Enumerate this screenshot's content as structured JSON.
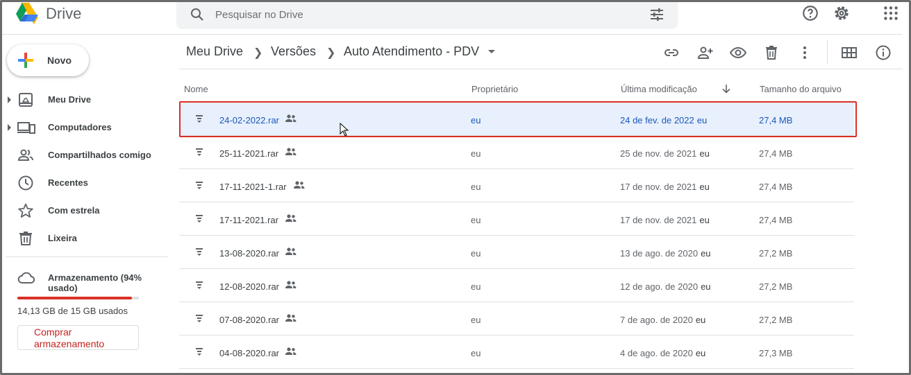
{
  "app": {
    "name": "Drive"
  },
  "search": {
    "placeholder": "Pesquisar no Drive"
  },
  "sidebar": {
    "new_label": "Novo",
    "items": [
      {
        "label": "Meu Drive",
        "icon": "my-drive-icon"
      },
      {
        "label": "Computadores",
        "icon": "computer-icon"
      },
      {
        "label": "Compartilhados comigo",
        "icon": "shared-icon"
      },
      {
        "label": "Recentes",
        "icon": "clock-icon"
      },
      {
        "label": "Com estrela",
        "icon": "star-icon"
      },
      {
        "label": "Lixeira",
        "icon": "trash-icon"
      }
    ],
    "storage": {
      "label": "Armazenamento (94% usado)",
      "usage_text": "14,13 GB de 15 GB usados",
      "used_fraction": 0.94,
      "buy_label": "Comprar armazenamento"
    }
  },
  "breadcrumb": [
    "Meu Drive",
    "Versões",
    "Auto Atendimento - PDV"
  ],
  "table": {
    "columns": [
      "Nome",
      "Proprietário",
      "Última modificação",
      "Tamanho do arquivo"
    ],
    "rows": [
      {
        "name": "24-02-2022.rar",
        "owner": "eu",
        "modified": "24 de fev. de 2022",
        "modified_by": "eu",
        "size": "27,4 MB",
        "selected": true
      },
      {
        "name": "25-11-2021.rar",
        "owner": "eu",
        "modified": "25 de nov. de 2021",
        "modified_by": "eu",
        "size": "27,4 MB"
      },
      {
        "name": "17-11-2021-1.rar",
        "owner": "eu",
        "modified": "17 de nov. de 2021",
        "modified_by": "eu",
        "size": "27,4 MB"
      },
      {
        "name": "17-11-2021.rar",
        "owner": "eu",
        "modified": "17 de nov. de 2021",
        "modified_by": "eu",
        "size": "27,4 MB"
      },
      {
        "name": "13-08-2020.rar",
        "owner": "eu",
        "modified": "13 de ago. de 2020",
        "modified_by": "eu",
        "size": "27,2 MB"
      },
      {
        "name": "12-08-2020.rar",
        "owner": "eu",
        "modified": "12 de ago. de 2020",
        "modified_by": "eu",
        "size": "27,2 MB"
      },
      {
        "name": "07-08-2020.rar",
        "owner": "eu",
        "modified": "7 de ago. de 2020",
        "modified_by": "eu",
        "size": "27,2 MB"
      },
      {
        "name": "04-08-2020.rar",
        "owner": "eu",
        "modified": "4 de ago. de 2020",
        "modified_by": "eu",
        "size": "27,3 MB"
      }
    ]
  },
  "colors": {
    "selection_bg": "#e8f0fe",
    "highlight_outline": "#d93025",
    "storage_bar": "#d93025",
    "link_blue": "#1a57b8"
  }
}
